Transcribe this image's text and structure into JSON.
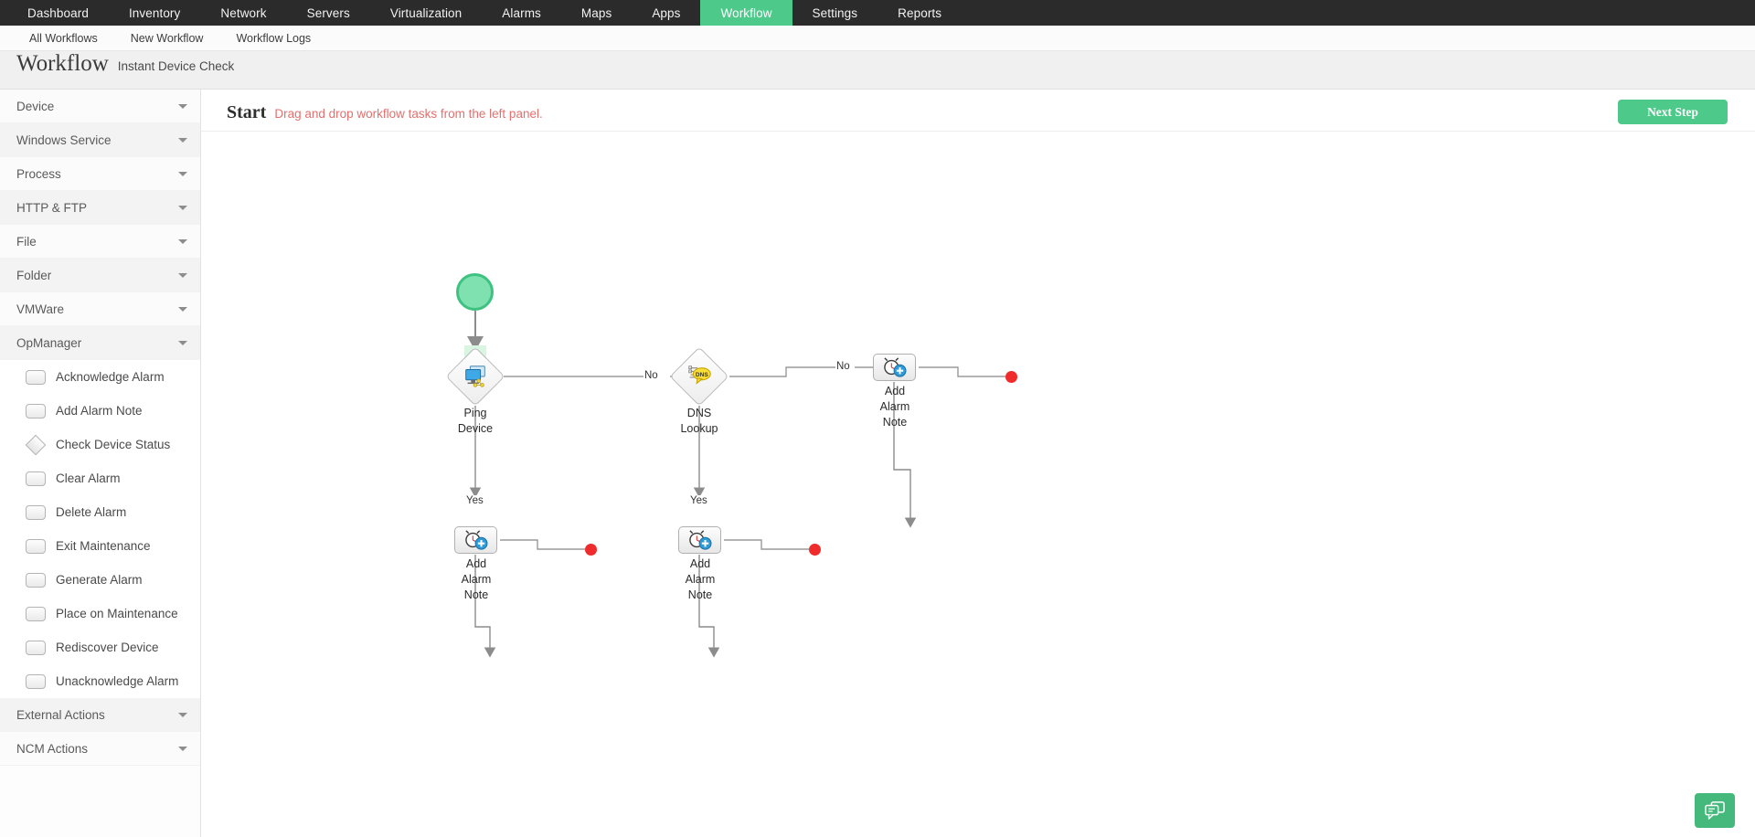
{
  "topnav": {
    "items": [
      {
        "label": "Dashboard",
        "active": false
      },
      {
        "label": "Inventory",
        "active": false
      },
      {
        "label": "Network",
        "active": false
      },
      {
        "label": "Servers",
        "active": false
      },
      {
        "label": "Virtualization",
        "active": false
      },
      {
        "label": "Alarms",
        "active": false
      },
      {
        "label": "Maps",
        "active": false
      },
      {
        "label": "Apps",
        "active": false
      },
      {
        "label": "Workflow",
        "active": true
      },
      {
        "label": "Settings",
        "active": false
      },
      {
        "label": "Reports",
        "active": false
      }
    ],
    "active_color": "#4dc98a",
    "bg_color": "#2b2b2b"
  },
  "subnav": {
    "items": [
      {
        "label": "All Workflows"
      },
      {
        "label": "New Workflow"
      },
      {
        "label": "Workflow Logs"
      }
    ]
  },
  "header": {
    "title": "Workflow",
    "subtitle": "Instant Device Check"
  },
  "sidebar": {
    "groups": [
      {
        "label": "Device"
      },
      {
        "label": "Windows Service"
      },
      {
        "label": "Process"
      },
      {
        "label": "HTTP & FTP"
      },
      {
        "label": "File"
      },
      {
        "label": "Folder"
      },
      {
        "label": "VMWare"
      },
      {
        "label": "OpManager"
      }
    ],
    "opmanager_tasks": [
      {
        "label": "Acknowledge Alarm",
        "icon": "rect-task-icon"
      },
      {
        "label": "Add Alarm Note",
        "icon": "rect-task-icon"
      },
      {
        "label": "Check Device Status",
        "icon": "diamond-decision-icon"
      },
      {
        "label": "Clear Alarm",
        "icon": "rect-task-icon"
      },
      {
        "label": "Delete Alarm",
        "icon": "rect-task-icon"
      },
      {
        "label": "Exit Maintenance",
        "icon": "rect-task-icon"
      },
      {
        "label": "Generate Alarm",
        "icon": "rect-task-icon"
      },
      {
        "label": "Place on Maintenance",
        "icon": "rect-task-icon"
      },
      {
        "label": "Rediscover Device",
        "icon": "rect-task-icon"
      },
      {
        "label": "Unacknowledge Alarm",
        "icon": "rect-task-icon"
      }
    ],
    "bottom_groups": [
      {
        "label": "External Actions"
      },
      {
        "label": "NCM Actions"
      }
    ]
  },
  "canvas": {
    "start_title": "Start",
    "hint": "Drag and drop workflow tasks from the left panel.",
    "hint_color": "#e3706e",
    "next_step_label": "Next Step",
    "nodes": [
      {
        "id": "start",
        "type": "start",
        "label": ""
      },
      {
        "id": "ping",
        "type": "decision",
        "label": "Ping\nDevice",
        "label_line1": "Ping",
        "label_line2": "Device",
        "icon": "device-monitor-icon"
      },
      {
        "id": "dns",
        "type": "decision",
        "label": "DNS\nLookup",
        "label_line1": "DNS",
        "label_line2": "Lookup",
        "icon": "dns-bubble-icon"
      },
      {
        "id": "note_top",
        "type": "task",
        "label_line1": "Add",
        "label_line2": "Alarm",
        "label_line3": "Note",
        "icon": "alarm-clock-add-icon"
      },
      {
        "id": "note_left",
        "type": "task",
        "label_line1": "Add",
        "label_line2": "Alarm",
        "label_line3": "Note",
        "icon": "alarm-clock-add-icon"
      },
      {
        "id": "note_mid",
        "type": "task",
        "label_line1": "Add",
        "label_line2": "Alarm",
        "label_line3": "Note",
        "icon": "alarm-clock-add-icon"
      }
    ],
    "edge_labels": [
      {
        "id": "ping_no",
        "text": "No"
      },
      {
        "id": "dns_no",
        "text": "No"
      },
      {
        "id": "ping_yes",
        "text": "Yes"
      },
      {
        "id": "dns_yes",
        "text": "Yes"
      }
    ],
    "terminator_color": "#ef2b2b"
  },
  "chat": {
    "icon": "chat-bubbles-icon",
    "color": "#45b97c"
  }
}
